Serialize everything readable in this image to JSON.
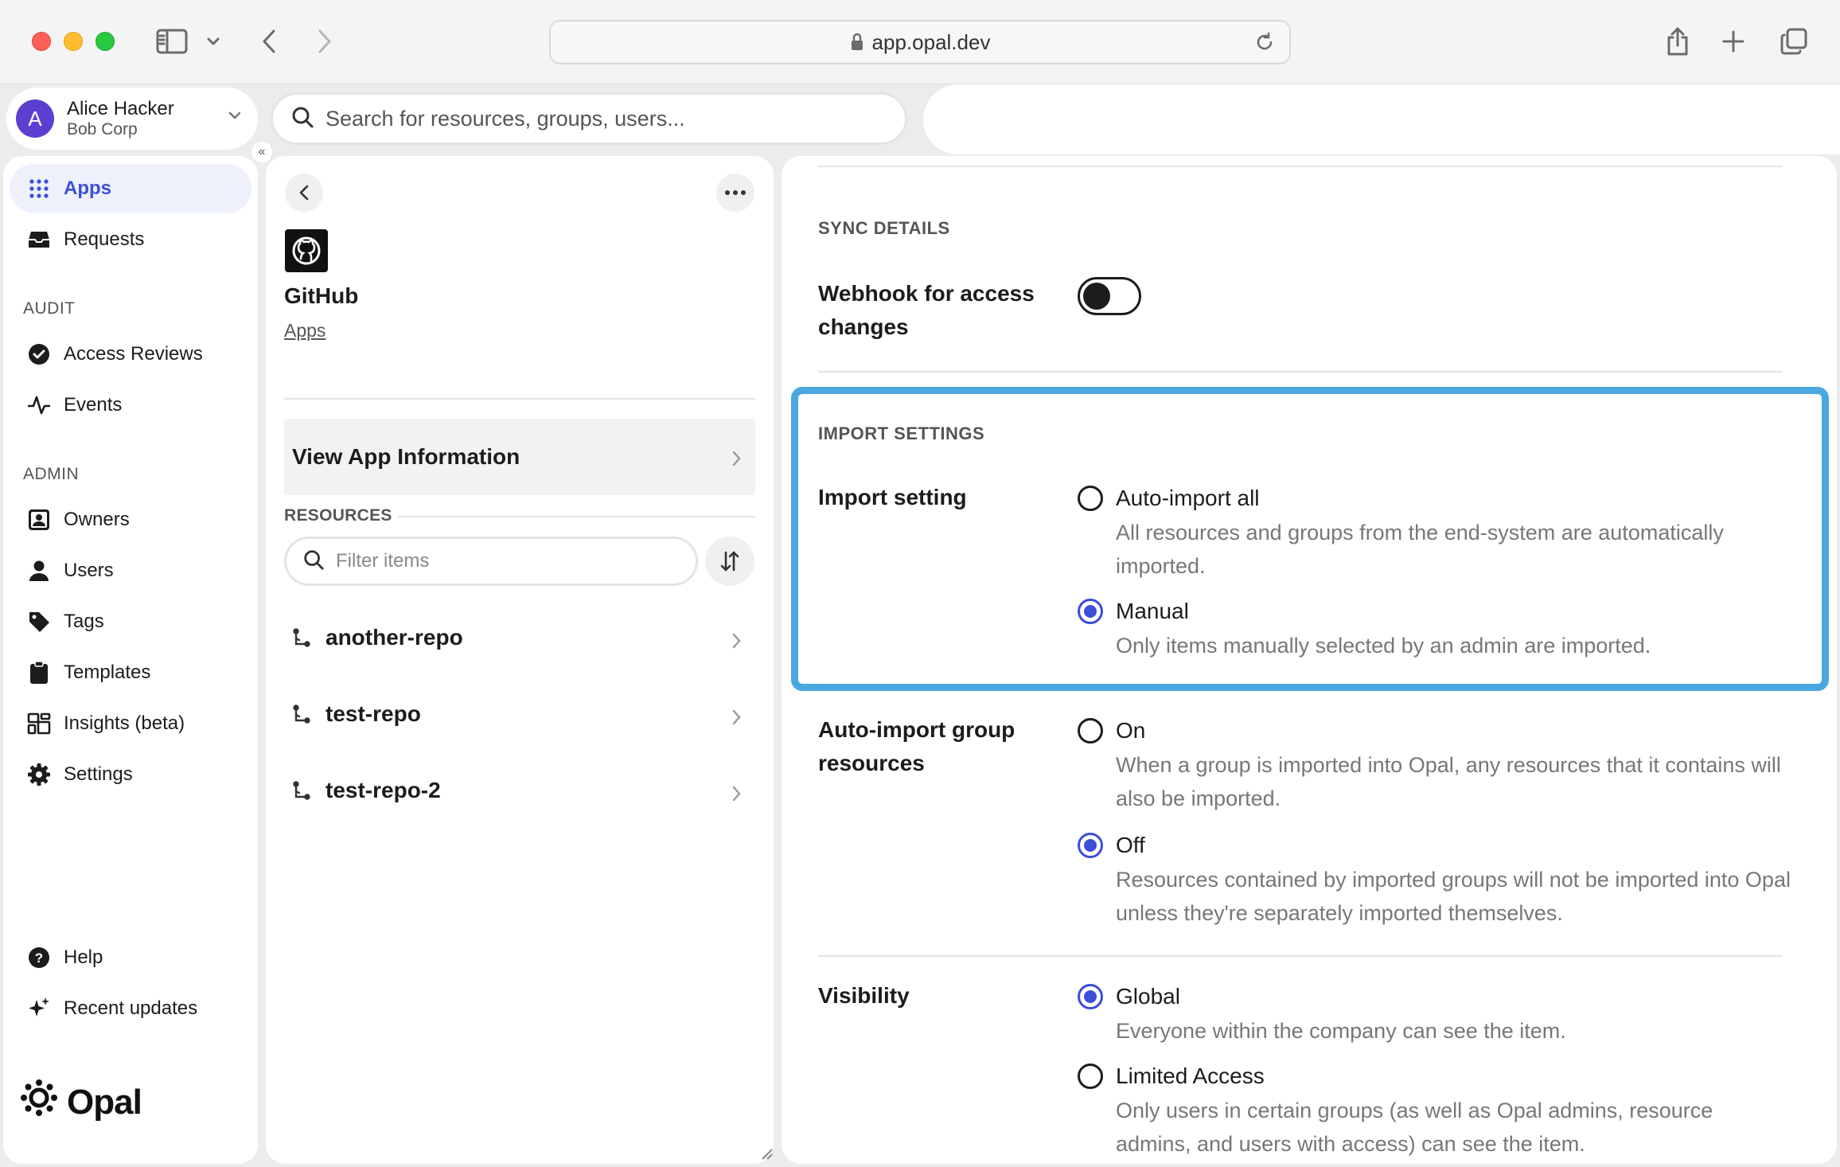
{
  "browser": {
    "url": "app.opal.dev"
  },
  "account": {
    "initial": "A",
    "name": "Alice Hacker",
    "org": "Bob Corp"
  },
  "search": {
    "placeholder": "Search for resources, groups, users..."
  },
  "sidebar": {
    "collapse_label": "«",
    "items_top": [
      {
        "label": "Apps",
        "icon": "grid-icon",
        "active": true
      },
      {
        "label": "Requests",
        "icon": "inbox-icon",
        "active": false
      }
    ],
    "audit_label": "AUDIT",
    "audit_items": [
      {
        "label": "Access Reviews",
        "icon": "check-circle-icon"
      },
      {
        "label": "Events",
        "icon": "activity-icon"
      }
    ],
    "admin_label": "ADMIN",
    "admin_items": [
      {
        "label": "Owners",
        "icon": "owner-badge-icon"
      },
      {
        "label": "Users",
        "icon": "user-icon"
      },
      {
        "label": "Tags",
        "icon": "tag-icon"
      },
      {
        "label": "Templates",
        "icon": "clipboard-icon"
      },
      {
        "label": "Insights (beta)",
        "icon": "insights-icon"
      },
      {
        "label": "Settings",
        "icon": "gear-icon"
      }
    ],
    "bottom_items": [
      {
        "label": "Help",
        "icon": "help-icon"
      },
      {
        "label": "Recent updates",
        "icon": "sparkle-icon"
      }
    ],
    "logo_text": "Opal"
  },
  "app_panel": {
    "title": "GitHub",
    "breadcrumb": "Apps",
    "view_info_label": "View App Information",
    "resources_label": "RESOURCES",
    "filter_placeholder": "Filter items",
    "resources": [
      {
        "name": "another-repo"
      },
      {
        "name": "test-repo"
      },
      {
        "name": "test-repo-2"
      }
    ]
  },
  "settings": {
    "sync_title": "SYNC DETAILS",
    "webhook_label": "Webhook for access changes",
    "webhook_enabled": false,
    "import_title": "IMPORT SETTINGS",
    "import_label": "Import setting",
    "import_options": [
      {
        "title": "Auto-import all",
        "desc": "All resources and groups from the end-system are automatically imported.",
        "selected": false
      },
      {
        "title": "Manual",
        "desc": "Only items manually selected by an admin are imported.",
        "selected": true
      }
    ],
    "group_label": "Auto-import group resources",
    "group_options": [
      {
        "title": "On",
        "desc": "When a group is imported into Opal, any resources that it contains will also be imported.",
        "selected": false
      },
      {
        "title": "Off",
        "desc": "Resources contained by imported groups will not be imported into Opal unless they're separately imported themselves.",
        "selected": true
      }
    ],
    "visibility_label": "Visibility",
    "visibility_options": [
      {
        "title": "Global",
        "desc": "Everyone within the company can see the item.",
        "selected": true
      },
      {
        "title": "Limited Access",
        "desc": "Only users in certain groups (as well as Opal admins, resource admins, and users with access) can see the item.",
        "selected": false
      }
    ]
  },
  "colors": {
    "accent": "#3b4fd8",
    "highlight_border": "#4aa8e0",
    "avatar": "#5b3fd1"
  }
}
